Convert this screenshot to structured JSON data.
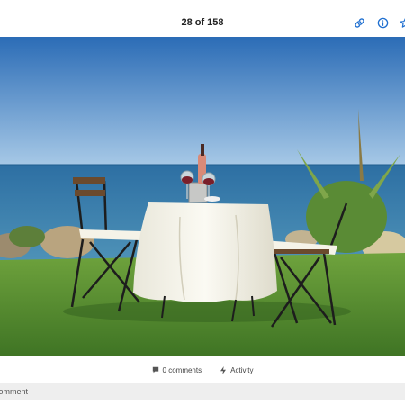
{
  "header": {
    "counter": "28 of 158",
    "icons": [
      "link-icon",
      "info-icon",
      "star-icon"
    ],
    "accent_color": "#1f6fd0"
  },
  "photo": {
    "subject": "table with wine bottle and glasses, two folding chairs on lawn by the sea"
  },
  "footer": {
    "comments_label": "0 comments",
    "activity_label": "Activity"
  },
  "comment_input": {
    "placeholder": "Comment"
  }
}
